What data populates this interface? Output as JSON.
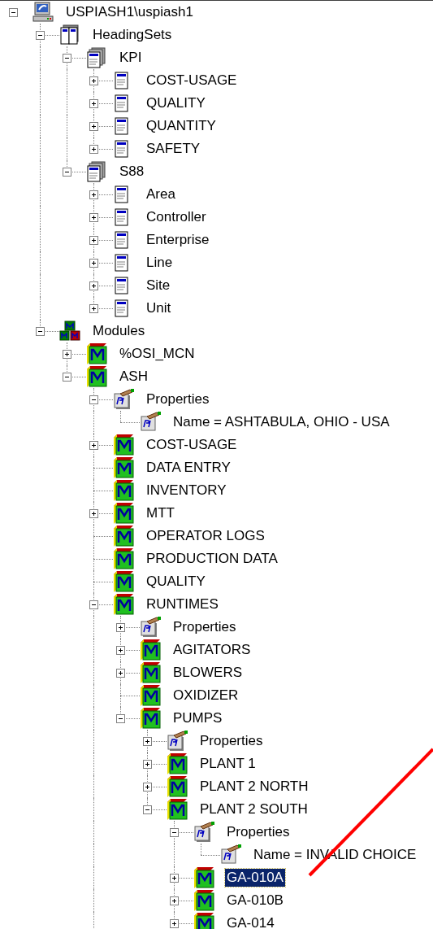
{
  "tree": [
    {
      "label": "USPIASH1\\uspiash1",
      "kind": "server",
      "expanded": true,
      "selected": false,
      "children": [
        {
          "label": "HeadingSets",
          "kind": "headingsets",
          "expanded": true,
          "selected": false,
          "children": [
            {
              "label": "KPI",
              "kind": "headingset",
              "expanded": true,
              "selected": false,
              "children": [
                {
                  "label": "COST-USAGE",
                  "kind": "heading",
                  "expanded": false,
                  "selected": false
                },
                {
                  "label": "QUALITY",
                  "kind": "heading",
                  "expanded": false,
                  "selected": false
                },
                {
                  "label": "QUANTITY",
                  "kind": "heading",
                  "expanded": false,
                  "selected": false
                },
                {
                  "label": "SAFETY",
                  "kind": "heading",
                  "expanded": false,
                  "selected": false
                }
              ]
            },
            {
              "label": "S88",
              "kind": "headingset",
              "expanded": true,
              "selected": false,
              "children": [
                {
                  "label": "Area",
                  "kind": "heading",
                  "expanded": false,
                  "selected": false
                },
                {
                  "label": "Controller",
                  "kind": "heading",
                  "expanded": false,
                  "selected": false
                },
                {
                  "label": "Enterprise",
                  "kind": "heading",
                  "expanded": false,
                  "selected": false
                },
                {
                  "label": "Line",
                  "kind": "heading",
                  "expanded": false,
                  "selected": false
                },
                {
                  "label": "Site",
                  "kind": "heading",
                  "expanded": false,
                  "selected": false
                },
                {
                  "label": "Unit",
                  "kind": "heading",
                  "expanded": false,
                  "selected": false
                }
              ]
            }
          ]
        },
        {
          "label": "Modules",
          "kind": "modules",
          "expanded": true,
          "selected": false,
          "children": [
            {
              "label": "%OSI_MCN",
              "kind": "module",
              "expanded": false,
              "selected": false
            },
            {
              "label": "ASH",
              "kind": "module",
              "expanded": true,
              "selected": false,
              "children": [
                {
                  "label": "Properties",
                  "kind": "properties",
                  "expanded": true,
                  "selected": false,
                  "children": [
                    {
                      "label": "Name = ASHTABULA, OHIO - USA",
                      "kind": "property",
                      "selected": false
                    }
                  ]
                },
                {
                  "label": "COST-USAGE",
                  "kind": "module",
                  "expanded": false,
                  "selected": false
                },
                {
                  "label": "DATA ENTRY",
                  "kind": "module",
                  "selected": false
                },
                {
                  "label": "INVENTORY",
                  "kind": "module",
                  "selected": false
                },
                {
                  "label": "MTT",
                  "kind": "module",
                  "expanded": false,
                  "selected": false
                },
                {
                  "label": "OPERATOR LOGS",
                  "kind": "module",
                  "selected": false
                },
                {
                  "label": "PRODUCTION DATA",
                  "kind": "module",
                  "selected": false
                },
                {
                  "label": "QUALITY",
                  "kind": "module",
                  "selected": false
                },
                {
                  "label": "RUNTIMES",
                  "kind": "module",
                  "expanded": true,
                  "selected": false,
                  "more_siblings": true,
                  "children": [
                    {
                      "label": "Properties",
                      "kind": "properties",
                      "expanded": false,
                      "selected": false
                    },
                    {
                      "label": "AGITATORS",
                      "kind": "module",
                      "expanded": false,
                      "selected": false
                    },
                    {
                      "label": "BLOWERS",
                      "kind": "module",
                      "expanded": false,
                      "selected": false
                    },
                    {
                      "label": "OXIDIZER",
                      "kind": "module",
                      "selected": false
                    },
                    {
                      "label": "PUMPS",
                      "kind": "module",
                      "expanded": true,
                      "selected": false,
                      "children": [
                        {
                          "label": "Properties",
                          "kind": "properties",
                          "expanded": false,
                          "selected": false
                        },
                        {
                          "label": "PLANT 1",
                          "kind": "module",
                          "expanded": false,
                          "selected": false
                        },
                        {
                          "label": "PLANT 2 NORTH",
                          "kind": "module",
                          "expanded": false,
                          "selected": false
                        },
                        {
                          "label": "PLANT 2 SOUTH",
                          "kind": "module",
                          "expanded": true,
                          "selected": false,
                          "children": [
                            {
                              "label": "Properties",
                              "kind": "properties",
                              "expanded": true,
                              "selected": false,
                              "children": [
                                {
                                  "label": "Name = INVALID CHOICE",
                                  "kind": "property",
                                  "selected": false
                                }
                              ]
                            },
                            {
                              "label": "GA-010A",
                              "kind": "module",
                              "expanded": false,
                              "selected": true
                            },
                            {
                              "label": "GA-010B",
                              "kind": "module",
                              "expanded": false,
                              "selected": false
                            },
                            {
                              "label": "GA-014",
                              "kind": "module",
                              "expanded": false,
                              "selected": false
                            }
                          ]
                        }
                      ]
                    }
                  ]
                }
              ]
            }
          ]
        }
      ]
    }
  ]
}
